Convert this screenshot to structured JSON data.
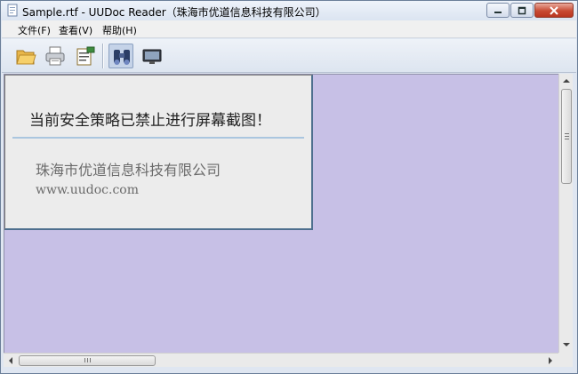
{
  "window": {
    "title": "Sample.rtf - UUDoc Reader（珠海市优道信息科技有限公司）"
  },
  "menu": {
    "items": [
      {
        "label": "文件(F)"
      },
      {
        "label": "查看(V)"
      },
      {
        "label": "帮助(H)"
      }
    ]
  },
  "toolbar": {
    "buttons": [
      "open-folder-icon",
      "print-icon",
      "properties-icon",
      "find-icon",
      "fullscreen-icon"
    ]
  },
  "notice": {
    "message": "当前安全策略已禁止进行屏幕截图！",
    "company": "珠海市优道信息科技有限公司",
    "url": "www.uudoc.com"
  },
  "colors": {
    "content_background": "#c7c0e6",
    "close_button": "#c84a33",
    "divider": "#aac6df"
  }
}
